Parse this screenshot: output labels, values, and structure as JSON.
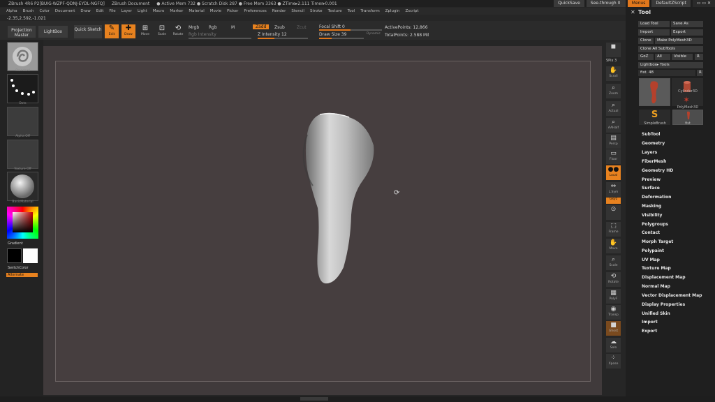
{
  "titlebar": {
    "items": [
      "ZBrush 4R6 P2[BUIG-WZPF-QDNJ-EYDL-NGFQ]",
      "ZBrush Document",
      "● Active Mem 732 ● Scratch Disk 287 ● Free Mem 3363 ● ZTime▸2.111 Timer▸0.001"
    ],
    "quicksave": "QuickSave",
    "seethrough": "See-through  0",
    "menus": "Menus",
    "defaultscript": "DefaultZScript"
  },
  "menubar": [
    "Alpha",
    "Brush",
    "Color",
    "Document",
    "Draw",
    "Edit",
    "File",
    "Layer",
    "Light",
    "Macro",
    "Marker",
    "Material",
    "Movie",
    "Picker",
    "Preferences",
    "Render",
    "Stencil",
    "Stroke",
    "Texture",
    "Tool",
    "Transform",
    "Zplugin",
    "Zscript"
  ],
  "coords": "-2.35,2.592,-1.021",
  "shelf": {
    "projection_master": "Projection Master",
    "lightbox": "LightBox",
    "quick_sketch": "Quick Sketch",
    "edit": "Edit",
    "draw": "Draw",
    "move": "Move",
    "scale": "Scale",
    "rotate": "Rotate",
    "mrgb": "Mrgb",
    "rgb": "Rgb",
    "m": "M",
    "rgb_intensity": "Rgb Intensity",
    "zadd": "Zadd",
    "zsub": "Zsub",
    "zcut": "Zcut",
    "z_intensity": "Z Intensity 12",
    "focal_shift": "Focal Shift 0",
    "draw_size": "Draw Size 39",
    "dynamic": "Dynamic",
    "active_points": "ActivePoints: 12,866",
    "total_points": "TotalPoints: 2.588 Mil"
  },
  "lefttray": {
    "brush_label": "Standard",
    "stroke_label": "Dots",
    "alpha_label": "Alpha Off",
    "texture_label": "Texture Off",
    "material_label": "BasicMaterial",
    "gradient": "Gradient",
    "switchcolor": "SwitchColor",
    "alternate": "Alternate"
  },
  "rightstrip": {
    "spix": "SPix 3",
    "scroll": "Scroll",
    "zoom": "Zoom",
    "actual": "Actual",
    "aahalf": "AAHalf",
    "persp": "Persp",
    "floor": "Floor",
    "local": "Local",
    "lsym": "L.Sym",
    "gxyz": "Gxyz",
    "frame": "Frame",
    "move": "Move",
    "scale": "Scale",
    "rotate": "Rotate",
    "polyf": "PolyF",
    "transp": "Transp",
    "ghost": "Ghost",
    "solo": "Solo",
    "xpose": "Xpose"
  },
  "toolpanel": {
    "title": "Tool",
    "load_tool": "Load Tool",
    "save_as": "Save As",
    "import": "Import",
    "export": "Export",
    "clone": "Clone",
    "make_polymesh": "Make PolyMesh3D",
    "clone_all": "Clone All SubTools",
    "goz": "GoZ",
    "all": "All",
    "visible": "Visible",
    "r": "R",
    "lightbox_tools": "Lightbox▸ Tools",
    "fist_slider": "fist. 48",
    "tiles": [
      "Cylinder3D",
      "PolyMesh3D",
      "SimpleBrush",
      "fist"
    ],
    "menu": [
      "SubTool",
      "Geometry",
      "Layers",
      "FiberMesh",
      "Geometry HD",
      "Preview",
      "Surface",
      "Deformation",
      "Masking",
      "Visibility",
      "Polygroups",
      "Contact",
      "Morph Target",
      "Polypaint",
      "UV Map",
      "Texture Map",
      "Displacement Map",
      "Normal Map",
      "Vector Displacement Map",
      "Display Properties",
      "Unified Skin",
      "Import",
      "Export"
    ]
  },
  "colors": {
    "accent": "#e8821f",
    "canvas": "#403a3b",
    "panel": "#1f1f1f"
  }
}
